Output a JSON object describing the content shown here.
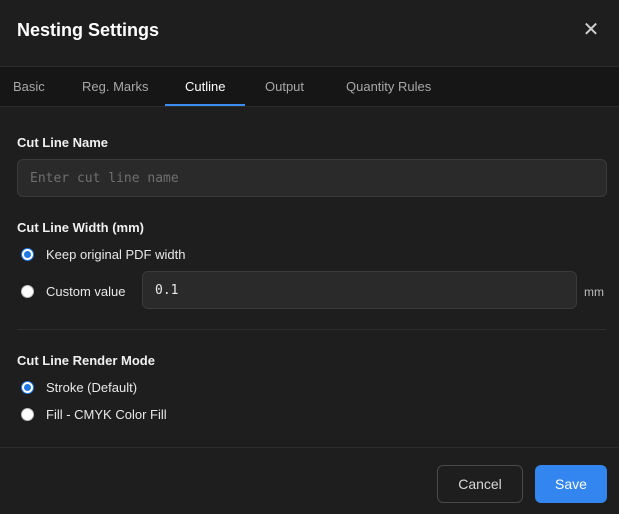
{
  "dialog": {
    "title": "Nesting Settings",
    "close_symbol": "✕"
  },
  "tabs": [
    {
      "label": "Basic",
      "active": false
    },
    {
      "label": "Reg. Marks",
      "active": false
    },
    {
      "label": "Cutline",
      "active": true
    },
    {
      "label": "Output",
      "active": false
    },
    {
      "label": "Quantity Rules",
      "active": false
    }
  ],
  "cutline": {
    "name_label": "Cut Line Name",
    "name_value": "",
    "name_placeholder": "Enter cut line name",
    "width_label": "Cut Line Width (mm)",
    "width_options": [
      {
        "label": "Keep original PDF width",
        "checked": true
      },
      {
        "label": "Custom value",
        "checked": false
      }
    ],
    "custom_value": "0.1",
    "unit": "mm",
    "render_label": "Cut Line Render Mode",
    "render_options": [
      {
        "label": "Stroke (Default)",
        "checked": true
      },
      {
        "label": "Fill - CMYK Color Fill",
        "checked": false
      }
    ]
  },
  "footer": {
    "cancel_label": "Cancel",
    "save_label": "Save"
  },
  "colors": {
    "accent": "#3385f0",
    "background": "#1e1e1e",
    "tab_bar": "#161616",
    "input_bg": "#2a2a2a"
  }
}
